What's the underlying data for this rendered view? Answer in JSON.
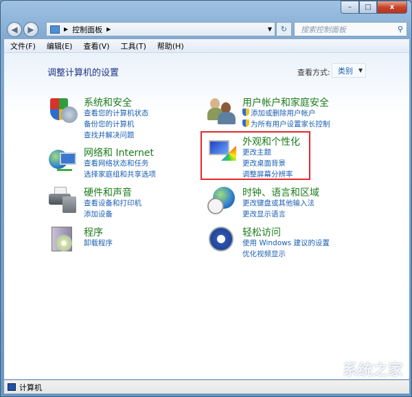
{
  "window": {
    "minimize": "–",
    "maximize": "□",
    "close": "x"
  },
  "nav": {
    "back": "◀",
    "forward": "▶",
    "breadcrumb": "控制面板",
    "refresh": "↻",
    "search_placeholder": "搜索控制面板"
  },
  "menu": [
    "文件(F)",
    "编辑(E)",
    "查看(V)",
    "工具(T)",
    "帮助(H)"
  ],
  "main": {
    "heading": "调整计算机的设置",
    "view_by_label": "查看方式:",
    "view_by_value": "类别"
  },
  "categories": [
    {
      "title": "系统和安全",
      "links": [
        "查看您的计算机状态",
        "备份您的计算机",
        "查找并解决问题"
      ]
    },
    {
      "title": "网络和 Internet",
      "links": [
        "查看网络状态和任务",
        "选择家庭组和共享选项"
      ]
    },
    {
      "title": "硬件和声音",
      "links": [
        "查看设备和打印机",
        "添加设备"
      ]
    },
    {
      "title": "程序",
      "links": [
        "卸载程序"
      ]
    },
    {
      "title": "用户帐户和家庭安全",
      "links": [
        "添加或删除用户帐户",
        "为所有用户设置家长控制"
      ]
    },
    {
      "title": "外观和个性化",
      "links": [
        "更改主题",
        "更改桌面背景",
        "调整屏幕分辨率"
      ]
    },
    {
      "title": "时钟、语言和区域",
      "links": [
        "更改键盘或其他输入法",
        "更改显示语言"
      ]
    },
    {
      "title": "轻松访问",
      "links": [
        "使用 Windows 建议的设置",
        "优化视频显示"
      ]
    }
  ],
  "status": {
    "text": "计算机"
  },
  "watermark": "系统之家"
}
